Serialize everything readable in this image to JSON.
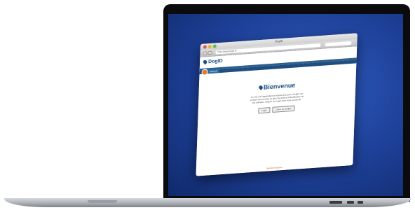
{
  "browser": {
    "window_title": "DogID",
    "url": "https://www.dogid.fr/",
    "back_label": "‹",
    "forward_label": "›"
  },
  "site": {
    "logo_text": "DogID",
    "nav": {
      "home_label": "Accueil"
    }
  },
  "welcome": {
    "title": "Bienvenue",
    "intro": "Ce site est l'application de lecture des puces DogID. Un compte vous permet de gérer les fiches d'identification de vos animaux. Cliquez sur Login pour vous connecter.",
    "login_label": "Login",
    "create_label": "Créer un compte"
  },
  "footer": {
    "text": "Mentions légales"
  },
  "colors": {
    "screen_blue": "#1d3f96",
    "brand_blue": "#1e4d7f",
    "accent_orange": "#e07a2a"
  }
}
